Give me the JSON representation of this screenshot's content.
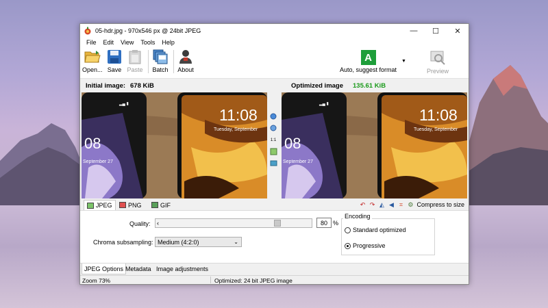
{
  "window": {
    "title": "05-hdr.jpg - 970x546 px @ 24bit JPEG",
    "controls": {
      "minimize": "—",
      "maximize": "☐",
      "close": "✕"
    }
  },
  "menu": [
    "File",
    "Edit",
    "View",
    "Tools",
    "Help"
  ],
  "toolbar": {
    "open": "Open...",
    "save": "Save",
    "paste": "Paste",
    "batch": "Batch",
    "about": "About",
    "format_letter": "A",
    "format_label": "Auto, suggest format",
    "preview": "Preview",
    "icons": {
      "open": "folder-open-icon",
      "save": "floppy-disk-icon",
      "paste": "clipboard-icon",
      "batch": "batch-files-icon",
      "about": "user-icon",
      "format": "auto-format-icon",
      "preview": "preview-icon"
    }
  },
  "captions": {
    "initial_label": "Initial image:",
    "initial_size": "678 KiB",
    "optimized_label": "Optimized image",
    "optimized_size": "135.61 KiB"
  },
  "preview_text": {
    "time": "11:08",
    "date": "Tuesday, September",
    "left_time_fragment": "08",
    "left_date_fragment": "September 27"
  },
  "zoom_tools": {
    "one_to_one": "1:1",
    "icons": [
      "zoom-in-icon",
      "zoom-out-icon",
      "actual-size-icon",
      "fit-icon",
      "split-view-icon"
    ]
  },
  "format_tabs": [
    "JPEG",
    "PNG",
    "GIF"
  ],
  "image_tools": {
    "compress_label": "Compress to size",
    "icons": [
      "rotate-left-icon",
      "rotate-right-icon",
      "flip-horizontal-icon",
      "flip-vertical-icon",
      "crop-icon",
      "compress-icon"
    ]
  },
  "jpeg_options": {
    "quality_label": "Quality:",
    "quality_value": "80",
    "quality_fraction": 0.8,
    "quality_unit": "%",
    "chroma_label": "Chroma subsampling:",
    "chroma_value": "Medium (4:2:0)",
    "encoding_legend": "Encoding",
    "standard_label": "Standard optimized",
    "progressive_label": "Progressive",
    "selected_encoding": "progressive"
  },
  "bottom_tabs": [
    "JPEG Options",
    "Metadata",
    "Image adjustments"
  ],
  "status": {
    "zoom": "Zoom 73%",
    "optimized": "Optimized: 24 bit JPEG image"
  },
  "colors": {
    "optimized_size": "#1a9a1a",
    "format_badge": "#1e9e3a"
  }
}
